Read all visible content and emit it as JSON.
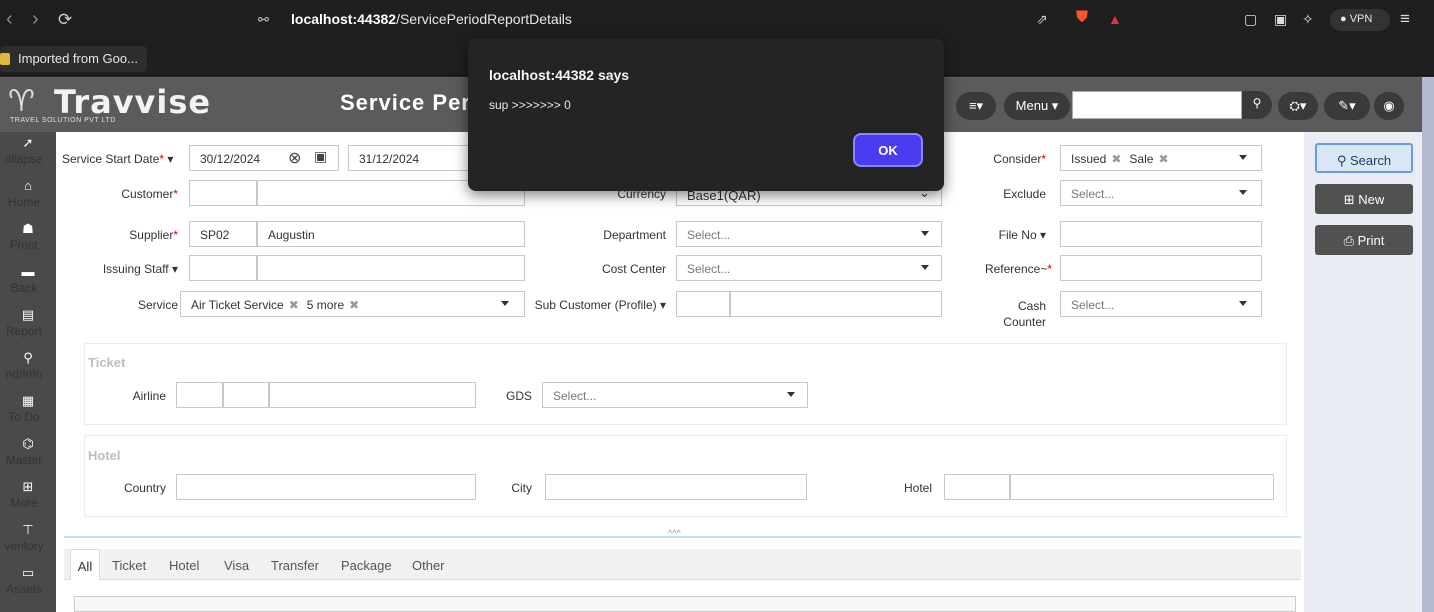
{
  "browser": {
    "url_prefix": "localhost:44382",
    "url_path": "/ServicePeriodReportDetails",
    "bookmark": "Imported from Goo...",
    "vpn_label": "VPN"
  },
  "header": {
    "logo_name": "Travvise",
    "logo_sub": "TRAVEL SOLUTION PVT LTD",
    "title": "Service Per",
    "menu_label": "Menu"
  },
  "sidebar": [
    {
      "label": "ollapse",
      "icon": "collapse-icon"
    },
    {
      "label": "Home",
      "icon": "home-icon"
    },
    {
      "label": "Front",
      "icon": "users-icon"
    },
    {
      "label": "Back",
      "icon": "card-icon"
    },
    {
      "label": "Report",
      "icon": "report-icon"
    },
    {
      "label": "nd/Info",
      "icon": "search-icon"
    },
    {
      "label": "To Do",
      "icon": "list-icon"
    },
    {
      "label": "Master",
      "icon": "bank-icon"
    },
    {
      "label": "More",
      "icon": "sitemap-icon"
    },
    {
      "label": "ventory",
      "icon": "cart-icon"
    },
    {
      "label": "Assets",
      "icon": "briefcase-icon"
    }
  ],
  "form": {
    "service_start_date_label": "Service Start Date",
    "date_from": "30/12/2024",
    "date_to": "31/12/2024",
    "customer_label": "Customer",
    "supplier_label": "Supplier",
    "supplier_code": "SP02",
    "supplier_name": "Augustin",
    "issuing_staff_label": "Issuing Staff",
    "service_label": "Service",
    "service_tag_1": "Air Ticket Service",
    "service_tag_2": "5 more",
    "currency_label": "Currency",
    "currency_value": "Base1(QAR)",
    "department_label": "Department",
    "cost_center_label": "Cost Center",
    "sub_customer_label": "Sub Customer (Profile)",
    "consider_label": "Consider",
    "consider_tag_1": "Issued",
    "consider_tag_2": "Sale",
    "exclude_label": "Exclude",
    "file_no_label": "File No",
    "reference_label": "Reference~",
    "cash_counter_label_1": "Cash",
    "cash_counter_label_2": "Counter",
    "select_placeholder": "Select..."
  },
  "ticket_section": {
    "title": "Ticket",
    "airline_label": "Airline",
    "gds_label": "GDS"
  },
  "hotel_section": {
    "title": "Hotel",
    "country_label": "Country",
    "city_label": "City",
    "hotel_label": "Hotel"
  },
  "actions": {
    "search": "Search",
    "new": "New",
    "print": "Print"
  },
  "tabs": [
    "All",
    "Ticket",
    "Hotel",
    "Visa",
    "Transfer",
    "Package",
    "Other"
  ],
  "alert": {
    "title": "localhost:44382 says",
    "message": "sup >>>>>>> 0",
    "ok": "OK"
  }
}
